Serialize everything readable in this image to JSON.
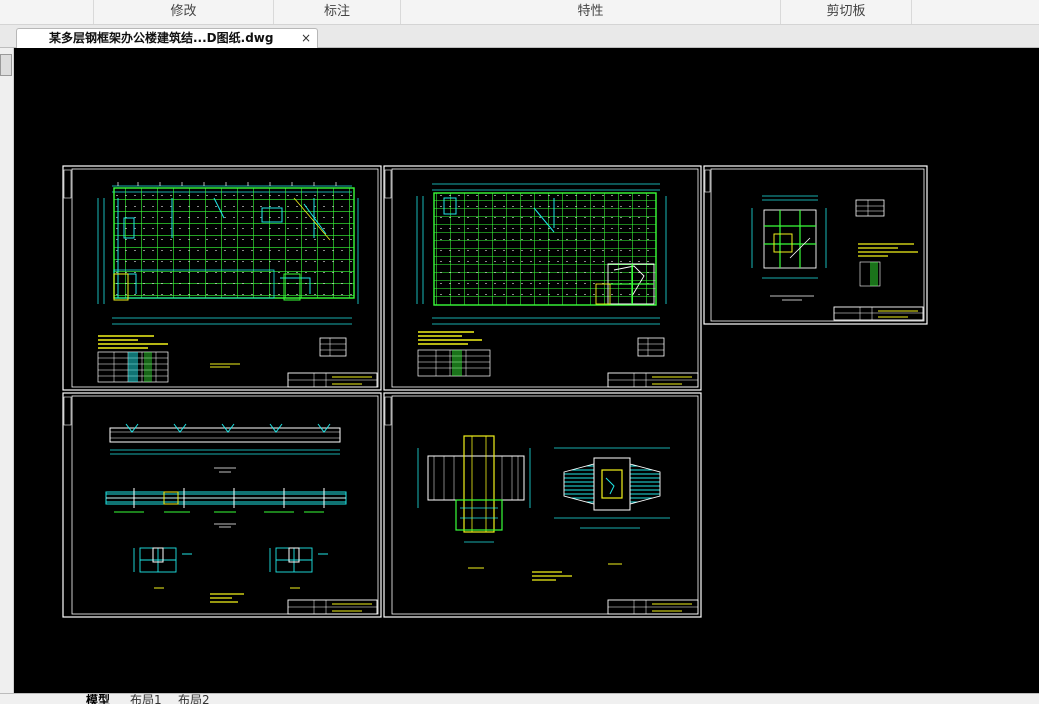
{
  "ribbon": {
    "panels": [
      {
        "label": "修改"
      },
      {
        "label": "标注"
      },
      {
        "label": "特性"
      },
      {
        "label": "剪切板"
      }
    ]
  },
  "document": {
    "tab_title": "某多层钢框架办公楼建筑结...D图纸.dwg",
    "close_glyph": "×"
  },
  "layout_tabs": [
    "模型",
    "布局1",
    "布局2"
  ],
  "colors": {
    "canvas": "#000000",
    "sheet_border": "#ffffff",
    "grid_green": "#39ff39",
    "cyan": "#1fe6e6",
    "yellow": "#f2f21b"
  }
}
